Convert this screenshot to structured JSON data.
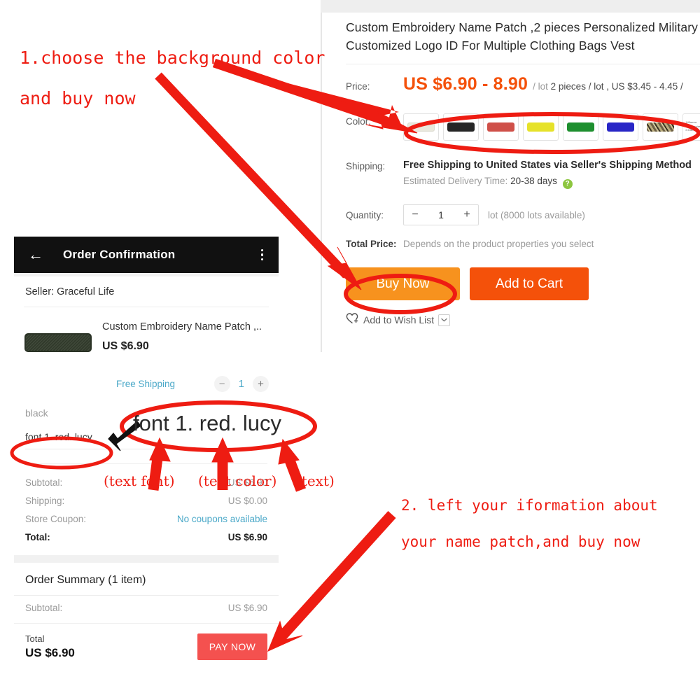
{
  "web_panel": {
    "product_title_line1": "Custom Embroidery Name Patch ,2 pieces Personalized Military",
    "product_title_line2": "Customized Logo ID For Multiple Clothing Bags Vest",
    "price": {
      "label": "Price:",
      "amount": "US $6.90 - 8.90",
      "unit_prefix": "/ lot",
      "unit_rest": "2 pieces / lot , US $3.45 - 4.45 /"
    },
    "color": {
      "label": "Color:",
      "swatches": [
        {
          "name": "cream",
          "hex": "#e9e8dd"
        },
        {
          "name": "black",
          "hex": "#262626"
        },
        {
          "name": "red",
          "hex": "#cf5049"
        },
        {
          "name": "yellow",
          "hex": "#e6e22a"
        },
        {
          "name": "green",
          "hex": "#1e8f2f"
        },
        {
          "name": "blue",
          "hex": "#2826c6"
        },
        {
          "name": "camo",
          "hex": "#9b8a5a"
        },
        {
          "name": "size-chart",
          "hex": "#ffffff",
          "tiny_lines": [
            "1.65mm se",
            "e 2.65mm size",
            "e 3.65mm"
          ]
        }
      ]
    },
    "shipping": {
      "label": "Shipping:",
      "main": "Free Shipping to United States via Seller's Shipping Method",
      "sub_prefix": "Estimated Delivery Time:",
      "sub_value": "20-38 days",
      "help_glyph": "?"
    },
    "quantity": {
      "label": "Quantity:",
      "minus": "−",
      "value": "1",
      "plus": "+",
      "note": "lot (8000 lots available)"
    },
    "total_price": {
      "label": "Total Price:",
      "value": "Depends on the product properties you select"
    },
    "buttons": {
      "buy_now": "Buy Now",
      "add_to_cart": "Add to Cart",
      "buy_now_hex": "#f7921e",
      "add_to_cart_hex": "#f4510a"
    },
    "wish_list": {
      "label": "Add to Wish List"
    }
  },
  "mobile_panel": {
    "header": {
      "back_glyph": "←",
      "title": "Order Confirmation"
    },
    "seller": "Seller: Graceful Life",
    "item": {
      "name": "Custom Embroidery Name Patch ,..",
      "price": "US $6.90",
      "free_shipping": "Free Shipping",
      "qty_minus": "−",
      "qty_value": "1",
      "qty_plus": "+"
    },
    "attribute": "black",
    "custom_text_field": "font 1. red. lucy",
    "summary_rows": [
      {
        "key": "Subtotal:",
        "value": "US $6.90",
        "link": false
      },
      {
        "key": "Shipping:",
        "value": "US $0.00",
        "link": false
      },
      {
        "key": "Store Coupon:",
        "value": "No coupons available",
        "link": true
      },
      {
        "key": "Total:",
        "value": "US $6.90",
        "link": false,
        "strong": true
      }
    ],
    "order_summary": {
      "title": "Order Summary (1 item)",
      "subtotal_key": "Subtotal:",
      "subtotal_value": "US $6.90"
    },
    "footer": {
      "total_label": "Total",
      "total_value": "US $6.90",
      "pay_now": "PAY NOW",
      "pay_now_hex": "#f4514f"
    }
  },
  "annotations": {
    "color_hex": "#ee1c12",
    "step1_line1": "1.choose the background color",
    "step1_line2": "and buy now",
    "step2_line1": "2. left your iformation about",
    "step2_line2": "your name patch,and buy now",
    "callout_text_font": "(text font)",
    "callout_text_color": "(text color)",
    "callout_text": "(text)",
    "highlight_text": "font 1. red. lucy"
  }
}
